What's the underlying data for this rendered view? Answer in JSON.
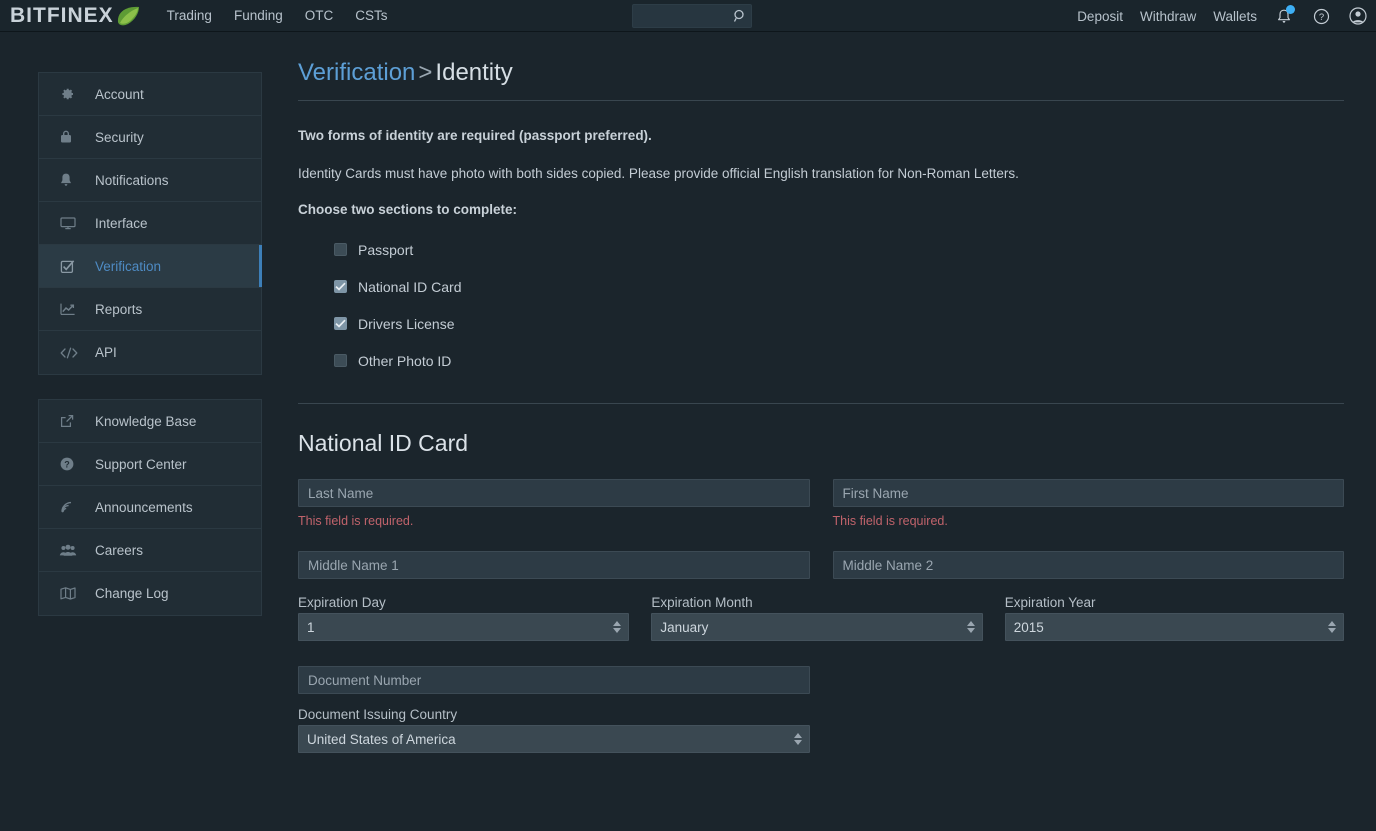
{
  "header": {
    "brand_word": "BITFINEX",
    "brand_leaf_icon": "leaf-icon",
    "nav_links": [
      {
        "label": "Trading"
      },
      {
        "label": "Funding"
      },
      {
        "label": "OTC"
      },
      {
        "label": "CSTs"
      }
    ],
    "search": {
      "value": "",
      "placeholder": "",
      "icon": "search-icon"
    },
    "right_links": [
      {
        "label": "Deposit"
      },
      {
        "label": "Withdraw"
      },
      {
        "label": "Wallets"
      }
    ],
    "icons": [
      {
        "name": "notification-bell-icon",
        "badge": true
      },
      {
        "name": "help-circle-icon"
      },
      {
        "name": "user-avatar-icon"
      }
    ]
  },
  "sidebar": {
    "group1": [
      {
        "label": "Account",
        "icon": "gear-icon",
        "active": false
      },
      {
        "label": "Security",
        "icon": "lock-icon",
        "active": false
      },
      {
        "label": "Notifications",
        "icon": "bell-icon",
        "active": false
      },
      {
        "label": "Interface",
        "icon": "monitor-icon",
        "active": false
      },
      {
        "label": "Verification",
        "icon": "checkbox-icon",
        "active": true
      },
      {
        "label": "Reports",
        "icon": "chart-line-icon",
        "active": false
      },
      {
        "label": "API",
        "icon": "code-icon",
        "active": false
      }
    ],
    "group2": [
      {
        "label": "Knowledge Base",
        "icon": "external-link-icon",
        "active": false
      },
      {
        "label": "Support Center",
        "icon": "question-circle-icon",
        "active": false
      },
      {
        "label": "Announcements",
        "icon": "rss-icon",
        "active": false
      },
      {
        "label": "Careers",
        "icon": "people-icon",
        "active": false
      },
      {
        "label": "Change Log",
        "icon": "book-icon",
        "active": false
      }
    ]
  },
  "breadcrumb": {
    "parent": "Verification",
    "separator": ">",
    "current": "Identity"
  },
  "intro": {
    "bold_line": "Two forms of identity are required (passport preferred).",
    "detail_line": "Identity Cards must have photo with both sides copied. Please provide official English translation for Non-Roman Letters.",
    "choose_label": "Choose two sections to complete:"
  },
  "id_options": [
    {
      "label": "Passport",
      "checked": false
    },
    {
      "label": "National ID Card",
      "checked": true
    },
    {
      "label": "Drivers License",
      "checked": true
    },
    {
      "label": "Other Photo ID",
      "checked": false
    }
  ],
  "form": {
    "section_title": "National ID Card",
    "last_name": {
      "value": "",
      "placeholder": "Last Name",
      "error": "This field is required."
    },
    "first_name": {
      "value": "",
      "placeholder": "First Name",
      "error": "This field is required."
    },
    "middle_name_1": {
      "value": "",
      "placeholder": "Middle Name 1"
    },
    "middle_name_2": {
      "value": "",
      "placeholder": "Middle Name 2"
    },
    "expiration_day": {
      "label": "Expiration Day",
      "value": "1"
    },
    "expiration_month": {
      "label": "Expiration Month",
      "value": "January"
    },
    "expiration_year": {
      "label": "Expiration Year",
      "value": "2015"
    },
    "document_number": {
      "value": "",
      "placeholder": "Document Number"
    },
    "document_issuing_country": {
      "label": "Document Issuing Country",
      "value": "United States of America"
    }
  },
  "colors": {
    "page_bg": "#1b252c",
    "panel_bg": "#212d35",
    "accent_blue": "#5d9fd6",
    "active_bar": "#3d7fb8",
    "error_red": "#c0636b",
    "leaf_green": "#5a9b32"
  }
}
